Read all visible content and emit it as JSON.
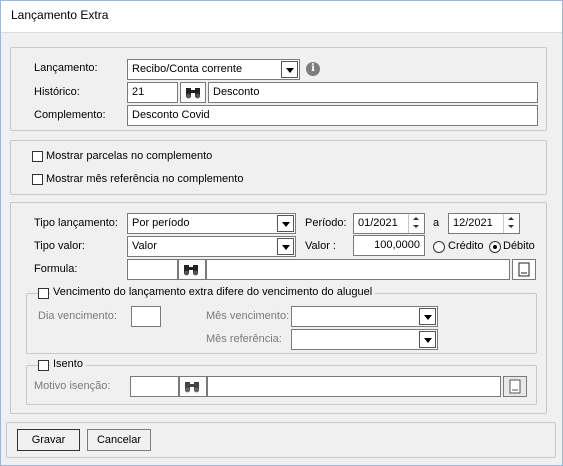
{
  "window": {
    "title": "Lançamento Extra"
  },
  "lancamento": {
    "label": "Lançamento:",
    "value": "Recibo/Conta corrente"
  },
  "historico": {
    "label": "Histórico:",
    "code": "21",
    "description": "Desconto"
  },
  "complemento": {
    "label": "Complemento:",
    "value": "Desconto Covid"
  },
  "options": {
    "mostrar_parcelas": "Mostrar parcelas no complemento",
    "mostrar_mes_ref": "Mostrar mês referência no complemento"
  },
  "tipo_lancamento": {
    "label": "Tipo lançamento:",
    "value": "Por período"
  },
  "periodo": {
    "label": "Período:",
    "start": "01/2021",
    "separator": "a",
    "end": "12/2021"
  },
  "tipo_valor": {
    "label": "Tipo valor:",
    "value": "Valor"
  },
  "valor": {
    "label": "Valor :",
    "amount": "100,0000",
    "credito": "Crédito",
    "debito": "Débito",
    "selected": "Débito"
  },
  "formula": {
    "label": "Formula:",
    "code": "",
    "text": ""
  },
  "vencimento": {
    "legend": "Vencimento do lançamento extra difere do vencimento do aluguel",
    "dia_label": "Dia vencimento:",
    "dia_value": "",
    "mes_venc_label": "Mês vencimento:",
    "mes_venc_value": "",
    "mes_ref_label": "Mês referência:",
    "mes_ref_value": ""
  },
  "isento": {
    "legend": "Isento",
    "motivo_label": "Motivo isenção:",
    "motivo_code": "",
    "motivo_text": ""
  },
  "buttons": {
    "gravar": "Gravar",
    "cancelar": "Cancelar"
  },
  "icons": {
    "info": "info-icon",
    "binoculars": "binoculars-icon",
    "notepad": "notepad-icon"
  }
}
